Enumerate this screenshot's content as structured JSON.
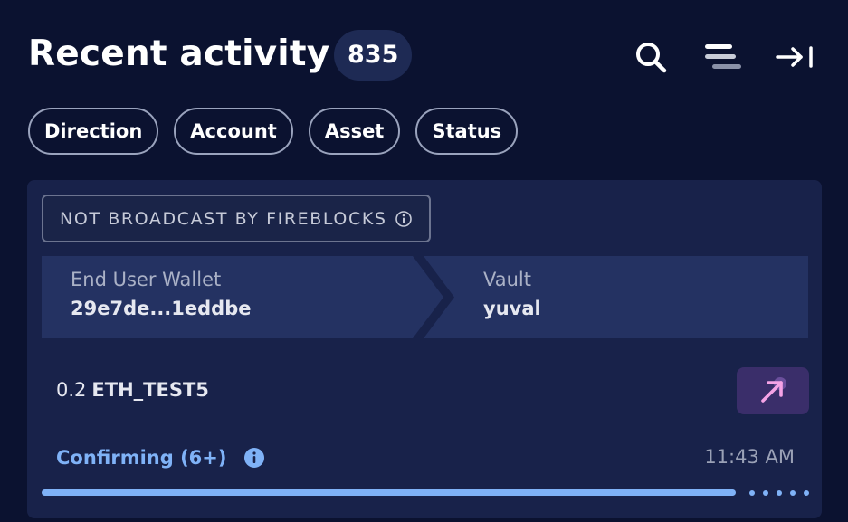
{
  "header": {
    "title": "Recent activity",
    "count": "835",
    "icons": [
      "search-icon",
      "filter-lines-icon",
      "collapse-to-right-icon"
    ]
  },
  "filters": [
    {
      "label": "Direction"
    },
    {
      "label": "Account"
    },
    {
      "label": "Asset"
    },
    {
      "label": "Status"
    }
  ],
  "transaction": {
    "broadcast_badge": "NOT BROADCAST BY FIREBLOCKS",
    "source": {
      "label": "End User Wallet",
      "value": "29e7de...1eddbe"
    },
    "destination": {
      "label": "Vault",
      "value": "yuval"
    },
    "amount": "0.2",
    "asset": "ETH_TEST5",
    "direction_icon": "arrow-up-right-icon",
    "status": "Confirming (6+)",
    "time": "11:43 AM",
    "progress": 0.905
  },
  "colors": {
    "background": "#0b1230",
    "card": "#18224a",
    "accent": "#7fb2f7",
    "direction_bg": "#3a2e6a",
    "direction_arrow": "#f5a3e6"
  }
}
